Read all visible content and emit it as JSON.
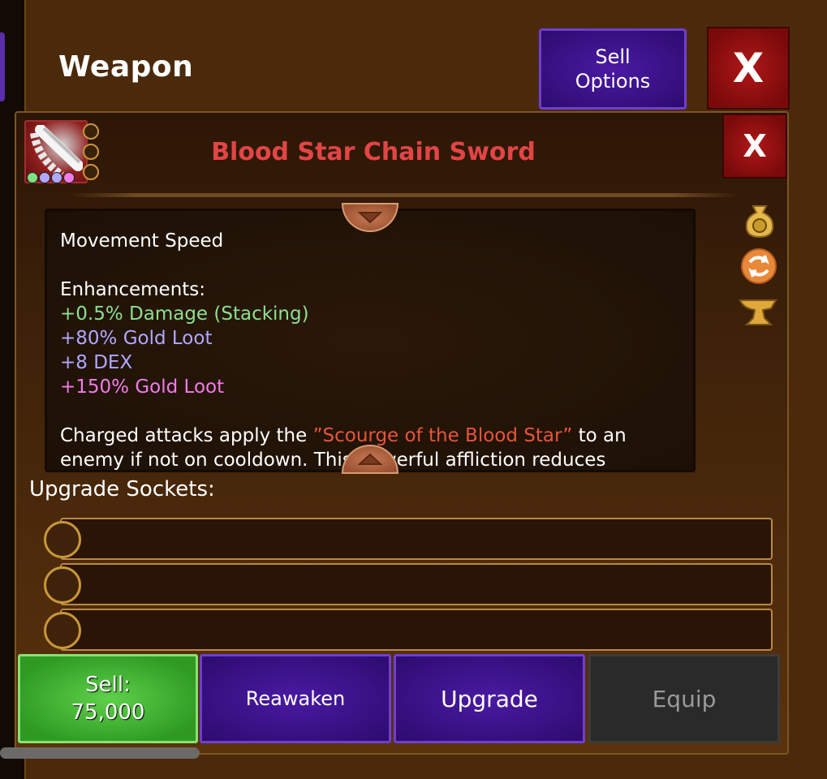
{
  "header": {
    "title": "Weapon",
    "sell_options": "Sell Options",
    "close": "X"
  },
  "item": {
    "name": "Blood Star Chain Sword",
    "close": "X",
    "gems": [
      "#7fe07f",
      "#b0a8ff",
      "#b0a8ff",
      "#f07ce8"
    ]
  },
  "description": {
    "movement_speed": "Movement Speed",
    "enhancements_label": "Enhancements:",
    "enhancements": [
      {
        "text": "+0.5% Damage (Stacking)",
        "color": "#8ee08e"
      },
      {
        "text": "+80% Gold Loot",
        "color": "#b0a8ff"
      },
      {
        "text": "+8 DEX",
        "color": "#b0a8ff"
      },
      {
        "text": "+150% Gold Loot",
        "color": "#f07ce8"
      }
    ],
    "ability_prefix": "Charged attacks apply the ",
    "ability_quote": "”Scourge of the Blood Star”",
    "ability_suffix": " to an",
    "ability_line2": "enemy if not on cooldown. This powerful affliction reduces"
  },
  "sockets": {
    "label": "Upgrade Sockets:",
    "count": 3
  },
  "actions": {
    "sell_label": "Sell:",
    "sell_price": "75,000",
    "reawaken": "Reawaken",
    "upgrade": "Upgrade",
    "equip": "Equip"
  },
  "icons": {
    "side": [
      "money-bag-icon",
      "swap-icon",
      "anvil-icon"
    ]
  }
}
